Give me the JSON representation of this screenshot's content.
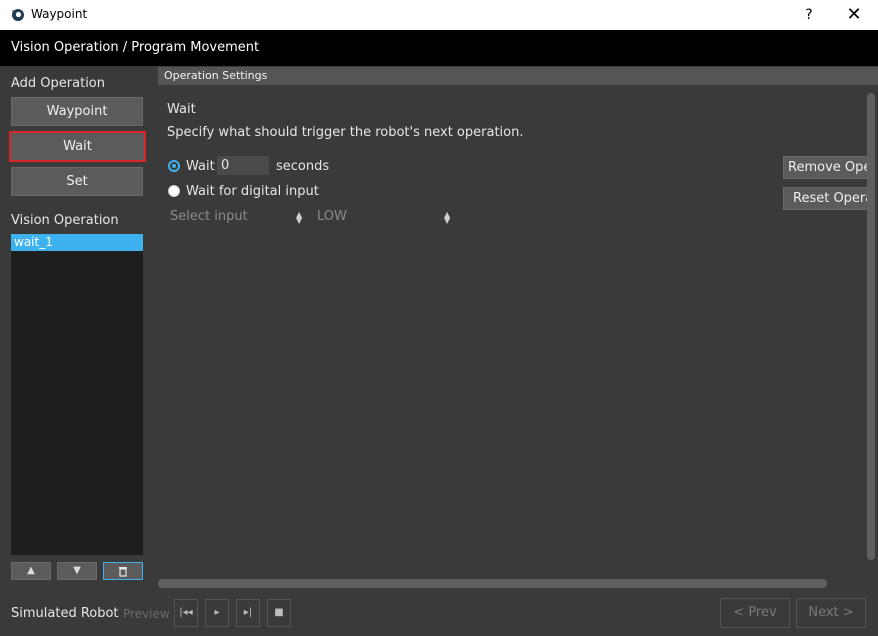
{
  "window": {
    "title": "Waypoint",
    "help": "?",
    "close": "✕"
  },
  "header": {
    "breadcrumb": "Vision Operation / Program Movement"
  },
  "left": {
    "add_operation_label": "Add Operation",
    "buttons": [
      "Waypoint",
      "Wait",
      "Set"
    ],
    "vision_operation_label": "Vision Operation",
    "operations": [
      "wait_1"
    ],
    "up_arrow": "▲",
    "down_arrow": "▼",
    "delete_icon": "🗑"
  },
  "settings": {
    "panel_title": "Operation Settings",
    "heading": "Wait",
    "description": "Specify what should trigger the robot's next operation.",
    "wait_option_label": "Wait",
    "wait_value": "0",
    "seconds_label": "seconds",
    "digital_option_label": "Wait for digital input",
    "select_input_placeholder": "Select input",
    "level_value": "LOW",
    "remove_button": "Remove Operation",
    "reset_button": "Reset Operation"
  },
  "bottom": {
    "simulated_robot_label": "Simulated Robot",
    "preview_label": "Preview",
    "prev_label": "< Prev",
    "next_label": "Next >"
  },
  "colors": {
    "accent": "#3db2ee",
    "highlight_border": "#d8262c",
    "background": "#3a3a3a"
  }
}
